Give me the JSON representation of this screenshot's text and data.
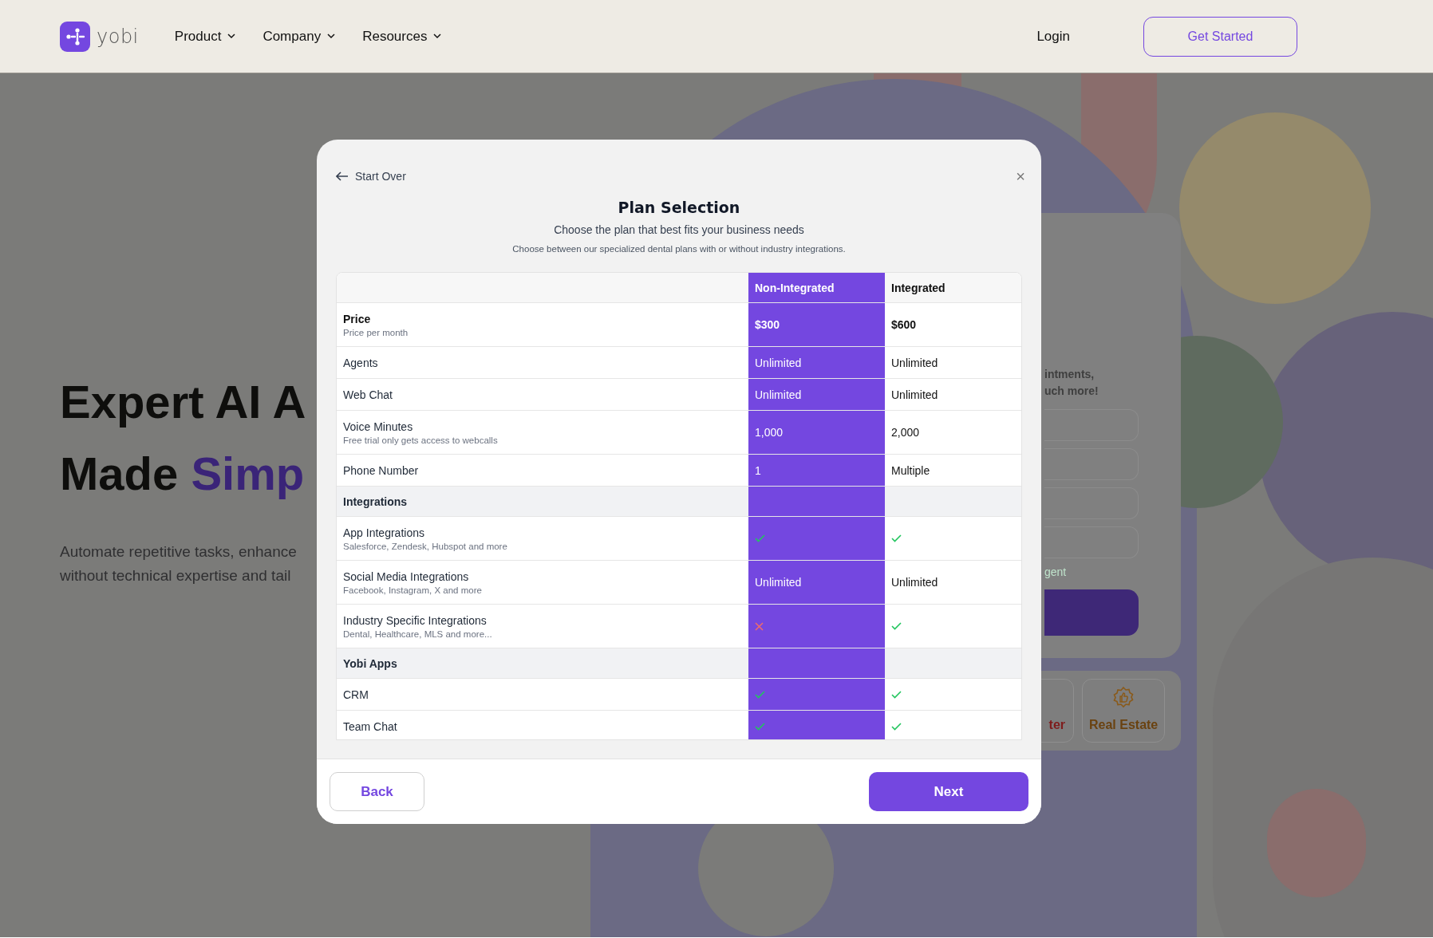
{
  "header": {
    "logo_text": "yobi",
    "nav": [
      {
        "label": "Product"
      },
      {
        "label": "Company"
      },
      {
        "label": "Resources"
      }
    ],
    "login": "Login",
    "cta": "Get Started"
  },
  "hero": {
    "line1": "Expert AI A",
    "line2_start": "Made ",
    "line2_highlight": "Simp",
    "paragraph_lines": [
      "Automate repetitive tasks, enhance",
      "without technical expertise and tail"
    ]
  },
  "signup_card": {
    "text_lines": [
      "intments,",
      "uch more!"
    ],
    "link": "gent"
  },
  "industries": [
    {
      "label": "ter",
      "color": "#7e1c1c",
      "icon": false
    },
    {
      "label": "Real Estate",
      "color": "#6a4210",
      "icon": true
    }
  ],
  "modal": {
    "back_link": "Start Over",
    "close": "×",
    "title": "Plan Selection",
    "subtitle": "Choose the plan that best fits your business needs",
    "note": "Choose between our specialized dental plans with or without industry integrations.",
    "table": {
      "columns": [
        {
          "label": "Non-Integrated",
          "selected": true
        },
        {
          "label": "Integrated",
          "selected": false
        }
      ],
      "rows": [
        {
          "kind": "price",
          "label": "Price",
          "sublabel": "Price per month",
          "values": [
            {
              "kind": "text",
              "text": "$300"
            },
            {
              "kind": "text",
              "text": "$600"
            }
          ]
        },
        {
          "kind": "feature",
          "label": "Agents",
          "values": [
            {
              "kind": "text",
              "text": "Unlimited"
            },
            {
              "kind": "text",
              "text": "Unlimited"
            }
          ]
        },
        {
          "kind": "feature",
          "label": "Web Chat",
          "values": [
            {
              "kind": "text",
              "text": "Unlimited"
            },
            {
              "kind": "text",
              "text": "Unlimited"
            }
          ]
        },
        {
          "kind": "feature",
          "label": "Voice Minutes",
          "sublabel": "Free trial only gets access to webcalls",
          "values": [
            {
              "kind": "text",
              "text": "1,000"
            },
            {
              "kind": "text",
              "text": "2,000"
            }
          ]
        },
        {
          "kind": "feature",
          "label": "Phone Number",
          "values": [
            {
              "kind": "text",
              "text": "1"
            },
            {
              "kind": "text",
              "text": "Multiple"
            }
          ]
        },
        {
          "kind": "section",
          "label": "Integrations"
        },
        {
          "kind": "feature",
          "label": "App Integrations",
          "sublabel": "Salesforce, Zendesk, Hubspot and more",
          "values": [
            {
              "kind": "check"
            },
            {
              "kind": "check"
            }
          ]
        },
        {
          "kind": "feature",
          "label": "Social Media Integrations",
          "sublabel": "Facebook, Instagram, X and more",
          "values": [
            {
              "kind": "text",
              "text": "Unlimited"
            },
            {
              "kind": "text",
              "text": "Unlimited"
            }
          ]
        },
        {
          "kind": "feature",
          "label": "Industry Specific Integrations",
          "sublabel": "Dental, Healthcare, MLS and more...",
          "values": [
            {
              "kind": "cross"
            },
            {
              "kind": "check"
            }
          ]
        },
        {
          "kind": "section",
          "label": "Yobi Apps"
        },
        {
          "kind": "feature",
          "label": "CRM",
          "values": [
            {
              "kind": "check"
            },
            {
              "kind": "check"
            }
          ]
        },
        {
          "kind": "feature",
          "label": "Team Chat",
          "values": [
            {
              "kind": "check"
            },
            {
              "kind": "check"
            }
          ]
        }
      ]
    },
    "back_button": "Back",
    "next_button": "Next"
  }
}
